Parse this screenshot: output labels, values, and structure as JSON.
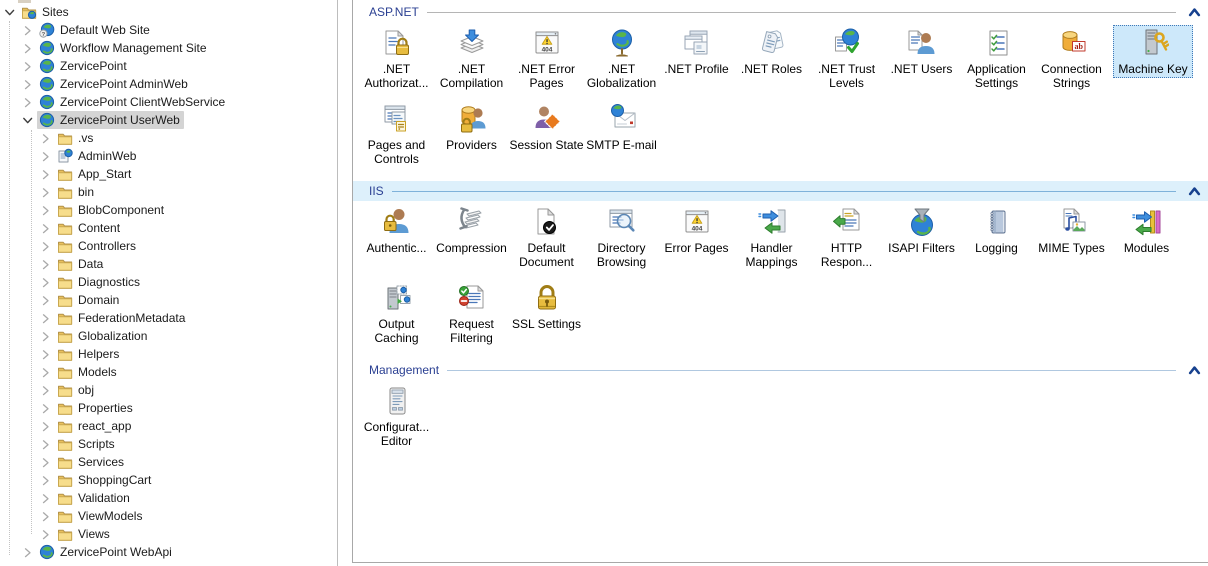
{
  "colors": {
    "selected_tile_bg": "#cde8fa",
    "selected_tile_border": "#4079b8",
    "tree_selected_bg": "#d4d4d4",
    "section_title": "#2a3f92",
    "iis_header_bg": "#ddf0fb",
    "collapse_chevron": "#17418e"
  },
  "tree": {
    "items": [
      {
        "label": "Sites",
        "level": 0,
        "state": "expanded",
        "icon": "sites-folder"
      },
      {
        "label": "Default Web Site",
        "level": 1,
        "state": "collapsed",
        "icon": "globe-question"
      },
      {
        "label": "Workflow Management Site",
        "level": 1,
        "state": "collapsed",
        "icon": "globe"
      },
      {
        "label": "ZervicePoint",
        "level": 1,
        "state": "collapsed",
        "icon": "globe"
      },
      {
        "label": "ZervicePoint AdminWeb",
        "level": 1,
        "state": "collapsed",
        "icon": "globe"
      },
      {
        "label": "ZervicePoint ClientWebService",
        "level": 1,
        "state": "collapsed",
        "icon": "globe"
      },
      {
        "label": "ZervicePoint UserWeb",
        "level": 1,
        "state": "expanded",
        "icon": "globe",
        "selected": true
      },
      {
        "label": ".vs",
        "level": 2,
        "state": "collapsed",
        "icon": "folder"
      },
      {
        "label": "AdminWeb",
        "level": 2,
        "state": "collapsed",
        "icon": "app"
      },
      {
        "label": "App_Start",
        "level": 2,
        "state": "collapsed",
        "icon": "folder"
      },
      {
        "label": "bin",
        "level": 2,
        "state": "collapsed",
        "icon": "folder"
      },
      {
        "label": "BlobComponent",
        "level": 2,
        "state": "collapsed",
        "icon": "folder"
      },
      {
        "label": "Content",
        "level": 2,
        "state": "collapsed",
        "icon": "folder"
      },
      {
        "label": "Controllers",
        "level": 2,
        "state": "collapsed",
        "icon": "folder"
      },
      {
        "label": "Data",
        "level": 2,
        "state": "collapsed",
        "icon": "folder"
      },
      {
        "label": "Diagnostics",
        "level": 2,
        "state": "collapsed",
        "icon": "folder"
      },
      {
        "label": "Domain",
        "level": 2,
        "state": "collapsed",
        "icon": "folder"
      },
      {
        "label": "FederationMetadata",
        "level": 2,
        "state": "collapsed",
        "icon": "folder"
      },
      {
        "label": "Globalization",
        "level": 2,
        "state": "collapsed",
        "icon": "folder"
      },
      {
        "label": "Helpers",
        "level": 2,
        "state": "collapsed",
        "icon": "folder"
      },
      {
        "label": "Models",
        "level": 2,
        "state": "collapsed",
        "icon": "folder"
      },
      {
        "label": "obj",
        "level": 2,
        "state": "collapsed",
        "icon": "folder"
      },
      {
        "label": "Properties",
        "level": 2,
        "state": "collapsed",
        "icon": "folder"
      },
      {
        "label": "react_app",
        "level": 2,
        "state": "collapsed",
        "icon": "folder"
      },
      {
        "label": "Scripts",
        "level": 2,
        "state": "collapsed",
        "icon": "folder"
      },
      {
        "label": "Services",
        "level": 2,
        "state": "collapsed",
        "icon": "folder"
      },
      {
        "label": "ShoppingCart",
        "level": 2,
        "state": "collapsed",
        "icon": "folder"
      },
      {
        "label": "Validation",
        "level": 2,
        "state": "collapsed",
        "icon": "folder"
      },
      {
        "label": "ViewModels",
        "level": 2,
        "state": "collapsed",
        "icon": "folder"
      },
      {
        "label": "Views",
        "level": 2,
        "state": "collapsed",
        "icon": "folder"
      },
      {
        "label": "ZervicePoint WebApi",
        "level": 1,
        "state": "collapsed",
        "icon": "globe"
      }
    ]
  },
  "features": {
    "sections": [
      {
        "title": "ASP.NET",
        "items": [
          {
            "lines": [
              ".NET",
              "Authorizat..."
            ],
            "icon": "doc-lock"
          },
          {
            "lines": [
              ".NET",
              "Compilation"
            ],
            "icon": "stack-arrow"
          },
          {
            "lines": [
              ".NET Error",
              "Pages"
            ],
            "icon": "page-404"
          },
          {
            "lines": [
              ".NET",
              "Globalization"
            ],
            "icon": "globe-stand"
          },
          {
            "lines": [
              ".NET Profile"
            ],
            "icon": "profile-windows"
          },
          {
            "lines": [
              ".NET Roles"
            ],
            "icon": "tags"
          },
          {
            "lines": [
              ".NET Trust",
              "Levels"
            ],
            "icon": "globe-check"
          },
          {
            "lines": [
              ".NET Users"
            ],
            "icon": "doc-person"
          },
          {
            "lines": [
              "Application",
              "Settings"
            ],
            "icon": "checklist"
          },
          {
            "lines": [
              "Connection",
              "Strings"
            ],
            "icon": "db-ab"
          },
          {
            "lines": [
              "Machine Key"
            ],
            "icon": "server-key",
            "selected": true
          },
          {
            "lines": [
              "Pages and",
              "Controls"
            ],
            "icon": "window-form"
          },
          {
            "lines": [
              "Providers"
            ],
            "icon": "db-person-lock"
          },
          {
            "lines": [
              "Session State"
            ],
            "icon": "person-diamond"
          },
          {
            "lines": [
              "SMTP E-mail"
            ],
            "icon": "envelope-globe"
          }
        ]
      },
      {
        "title": "IIS",
        "header_highlighted": true,
        "items": [
          {
            "lines": [
              "Authentic..."
            ],
            "icon": "person-lock"
          },
          {
            "lines": [
              "Compression"
            ],
            "icon": "clamp"
          },
          {
            "lines": [
              "Default",
              "Document"
            ],
            "icon": "doc-check"
          },
          {
            "lines": [
              "Directory",
              "Browsing"
            ],
            "icon": "window-search"
          },
          {
            "lines": [
              "Error Pages"
            ],
            "icon": "page-404"
          },
          {
            "lines": [
              "Handler",
              "Mappings"
            ],
            "icon": "arrows-page"
          },
          {
            "lines": [
              "HTTP",
              "Respon..."
            ],
            "icon": "doc-arrow"
          },
          {
            "lines": [
              "ISAPI Filters"
            ],
            "icon": "globe-funnel"
          },
          {
            "lines": [
              "Logging"
            ],
            "icon": "notebook"
          },
          {
            "lines": [
              "MIME Types"
            ],
            "icon": "doc-media"
          },
          {
            "lines": [
              "Modules"
            ],
            "icon": "arrows-bars"
          },
          {
            "lines": [
              "Output",
              "Caching"
            ],
            "icon": "server-pages"
          },
          {
            "lines": [
              "Request",
              "Filtering"
            ],
            "icon": "doc-filter"
          },
          {
            "lines": [
              "SSL Settings"
            ],
            "icon": "padlock"
          }
        ]
      },
      {
        "title": "Management",
        "items": [
          {
            "lines": [
              "Configurat...",
              "Editor"
            ],
            "icon": "tablet"
          }
        ]
      }
    ]
  }
}
